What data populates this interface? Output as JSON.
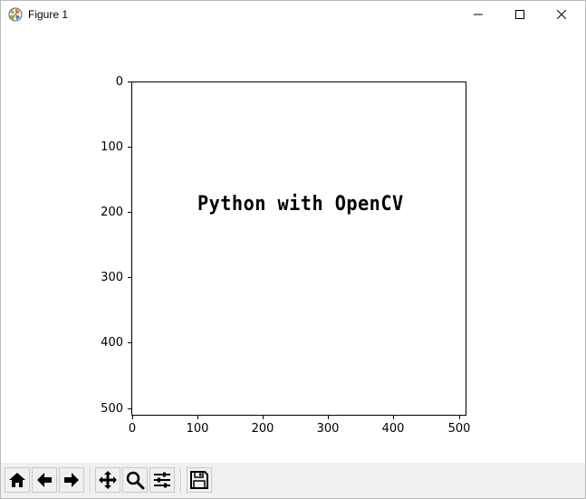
{
  "window": {
    "title": "Figure 1"
  },
  "figure": {
    "annotation_text": "Python with OpenCV",
    "yticks": [
      "0",
      "100",
      "200",
      "300",
      "400",
      "500"
    ],
    "xticks": [
      "0",
      "100",
      "200",
      "300",
      "400",
      "500"
    ]
  },
  "toolbar": {
    "buttons": [
      "home-icon",
      "back-icon",
      "forward-icon",
      "pan-icon",
      "zoom-icon",
      "configure-subplots-icon",
      "save-icon"
    ]
  },
  "colors": {
    "toolbar_bg": "#f0f0f0",
    "plot_bg": "#ffffff",
    "text": "#000000"
  }
}
